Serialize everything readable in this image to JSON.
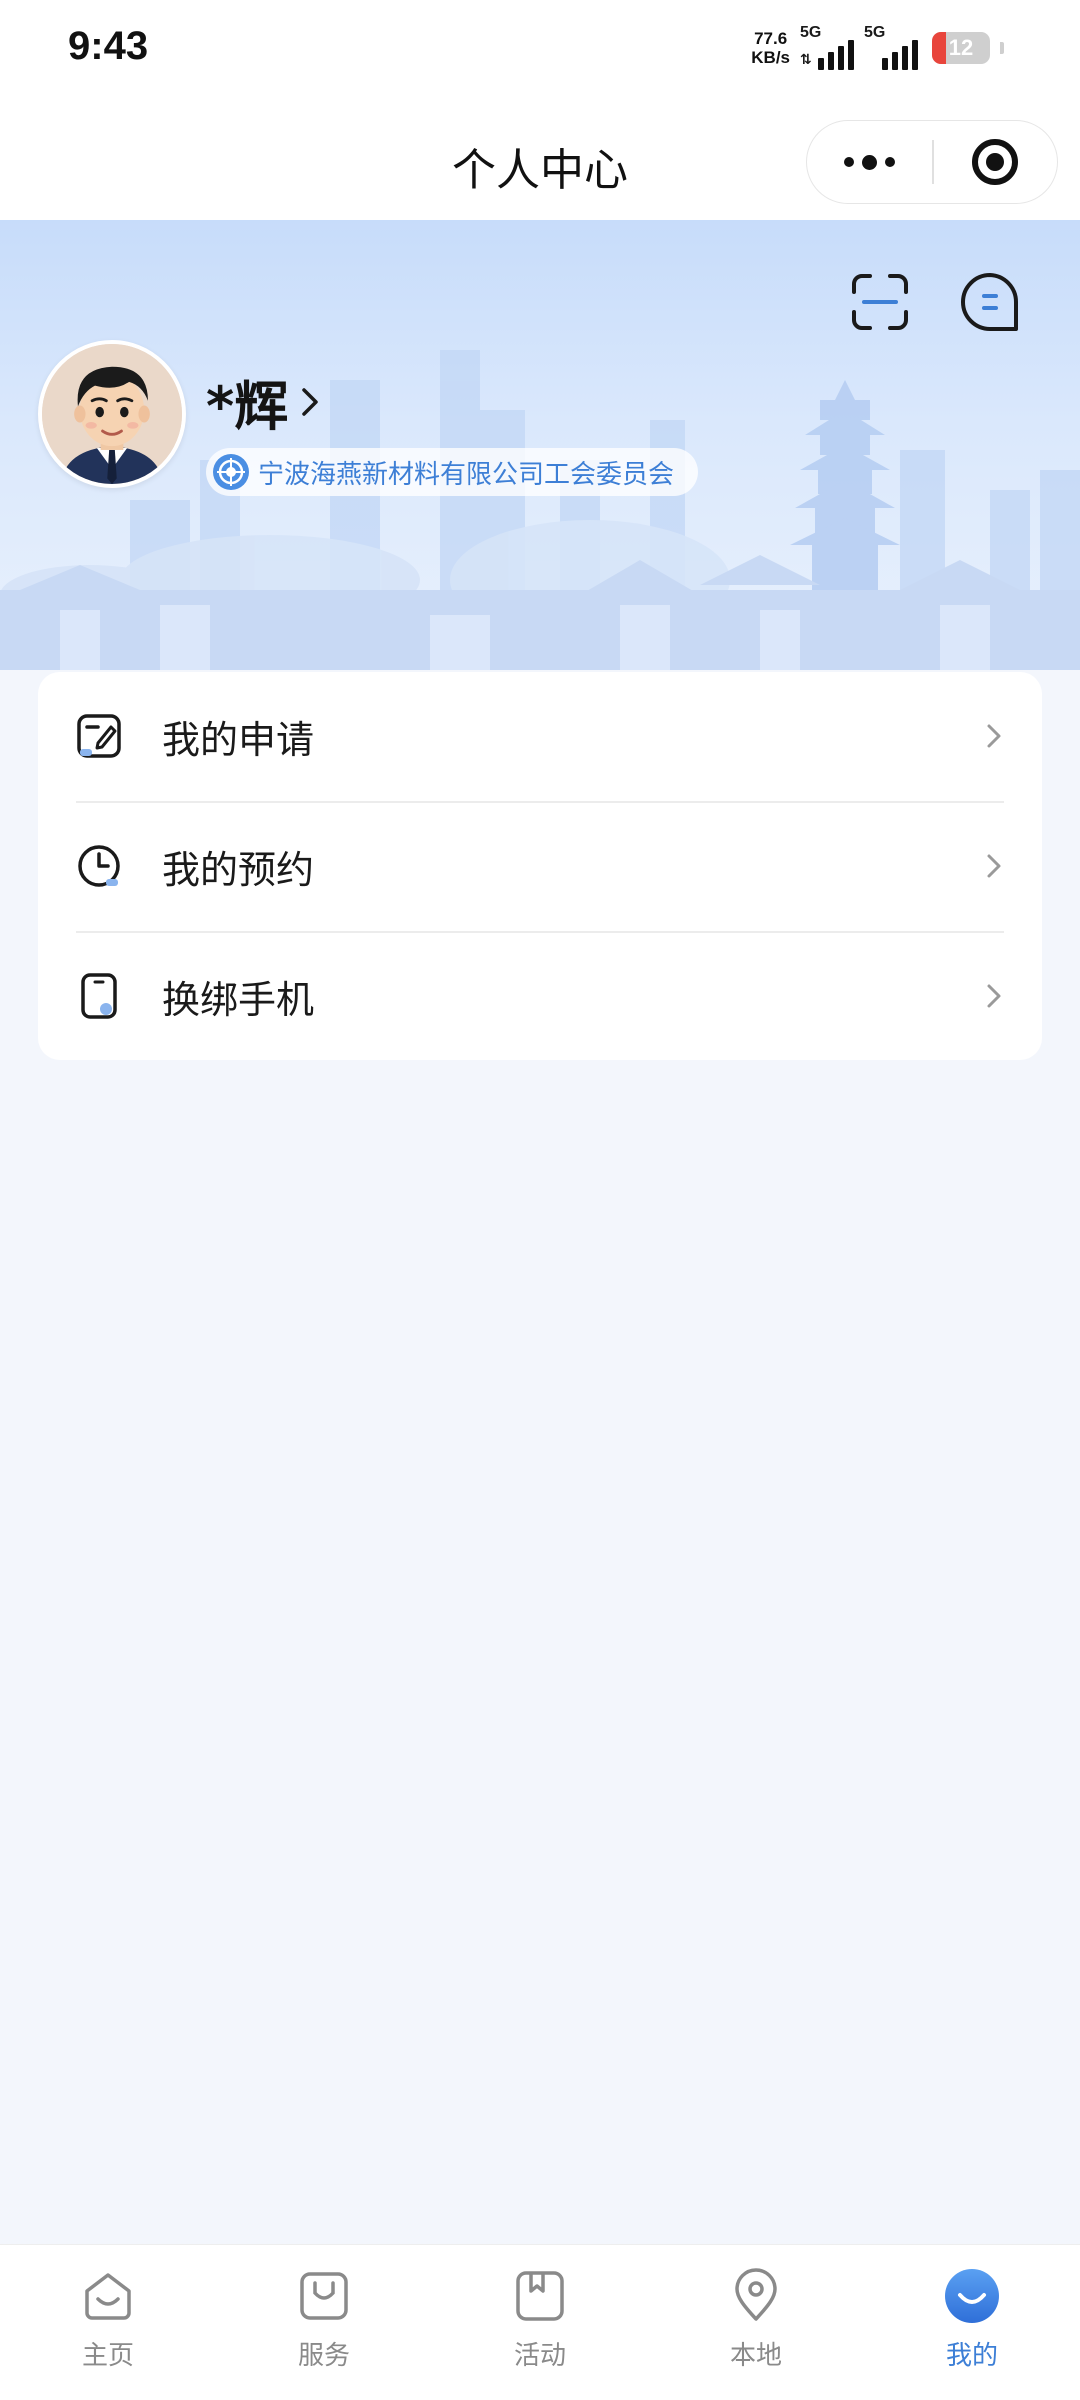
{
  "status_bar": {
    "time": "9:43",
    "net_speed_value": "77.6",
    "net_speed_unit": "KB/s",
    "signal_1_type": "5G",
    "signal_2_type": "5G",
    "battery_level": "12",
    "battery_color": "#e8453c"
  },
  "nav": {
    "title": "个人中心",
    "more_icon": "more-dots-icon",
    "close_icon": "target-close-icon"
  },
  "profile": {
    "name": "*辉",
    "organization": "宁波海燕新材料有限公司工会委员会",
    "scan_icon": "scan-icon",
    "message_icon": "message-icon"
  },
  "menu": {
    "items": [
      {
        "label": "我的申请",
        "icon": "application-icon"
      },
      {
        "label": "我的预约",
        "icon": "clock-icon"
      },
      {
        "label": "换绑手机",
        "icon": "phone-icon"
      }
    ]
  },
  "tabbar": {
    "active_color": "#3d7fd6",
    "inactive_color": "#8a8a8a",
    "items": [
      {
        "label": "主页",
        "icon": "home-icon"
      },
      {
        "label": "服务",
        "icon": "bag-icon"
      },
      {
        "label": "活动",
        "icon": "bookmark-icon"
      },
      {
        "label": "本地",
        "icon": "location-icon"
      },
      {
        "label": "我的",
        "icon": "smile-icon"
      }
    ]
  }
}
